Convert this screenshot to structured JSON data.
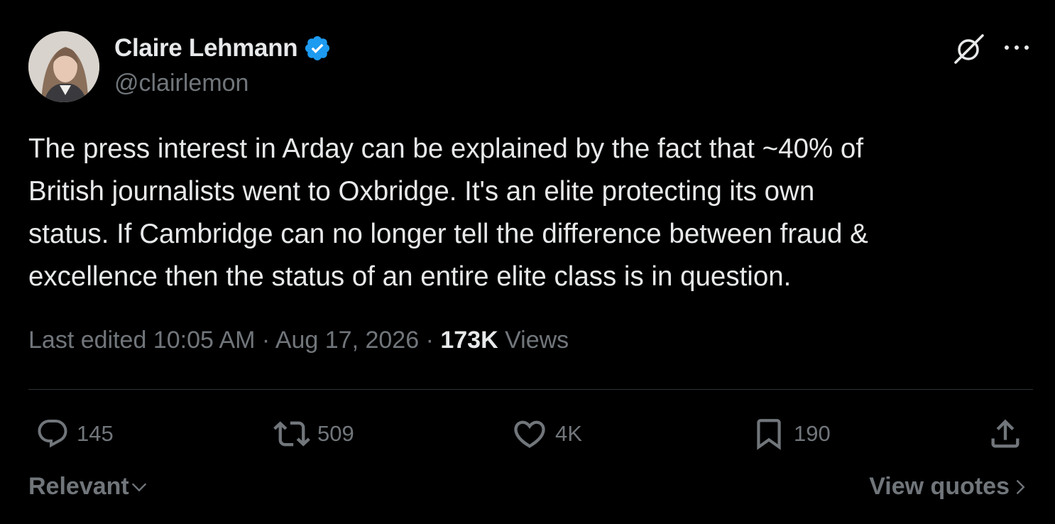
{
  "author": {
    "name": "Claire Lehmann",
    "handle": "@clairlemon",
    "verified": true,
    "avatar_icon": "avatar-photo"
  },
  "header_actions": {
    "grok_icon": "grok-icon",
    "more_icon": "more-icon"
  },
  "tweet": {
    "text": "The press interest in Arday can be explained by the fact that ~40% of\nBritish journalists went to Oxbridge. It's an elite protecting its own\nstatus. If Cambridge can no longer tell the difference between fraud &\nexcellence then the status of an entire elite class is in question."
  },
  "meta": {
    "edited_label": "Last edited",
    "time": "10:05 AM",
    "separator": "·",
    "date": "Aug 17, 2026",
    "views_count": "173K",
    "views_label": "Views"
  },
  "actions": {
    "reply": {
      "icon": "reply-icon",
      "count": "145"
    },
    "retweet": {
      "icon": "retweet-icon",
      "count": "509"
    },
    "like": {
      "icon": "heart-icon",
      "count": "4K"
    },
    "bookmark": {
      "icon": "bookmark-icon",
      "count": "190"
    },
    "share": {
      "icon": "share-icon"
    }
  },
  "footer": {
    "sort_label": "Relevant",
    "view_quotes_label": "View quotes"
  },
  "colors": {
    "background": "#000000",
    "primary_text": "#e7e9ea",
    "secondary_text": "#71767b",
    "divider": "#2f3336",
    "verified_blue": "#1d9bf0"
  }
}
